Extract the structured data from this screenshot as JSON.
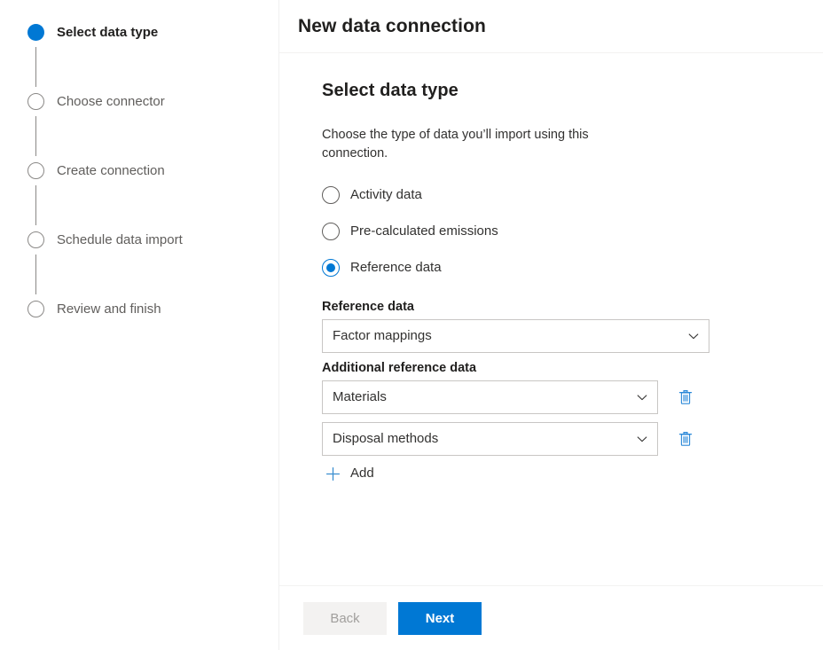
{
  "stepper": {
    "steps": [
      {
        "label": "Select data type",
        "state": "active"
      },
      {
        "label": "Choose connector",
        "state": "inactive"
      },
      {
        "label": "Create connection",
        "state": "inactive"
      },
      {
        "label": "Schedule data import",
        "state": "inactive"
      },
      {
        "label": "Review and finish",
        "state": "inactive"
      }
    ]
  },
  "panel": {
    "title": "New data connection",
    "section_title": "Select data type",
    "description": "Choose the type of data you’ll import using this connection.",
    "radio_options": [
      {
        "label": "Activity data",
        "checked": false
      },
      {
        "label": "Pre-calculated emissions",
        "checked": false
      },
      {
        "label": "Reference data",
        "checked": true
      }
    ],
    "reference_data": {
      "label": "Reference data",
      "value": "Factor mappings"
    },
    "additional_reference_data": {
      "label": "Additional reference data",
      "items": [
        {
          "value": "Materials",
          "delete_label": "Delete"
        },
        {
          "value": "Disposal methods",
          "delete_label": "Delete"
        }
      ],
      "add_label": "Add"
    }
  },
  "footer": {
    "back_label": "Back",
    "next_label": "Next"
  },
  "colors": {
    "accent": "#0078d4",
    "border": "#c8c6c4",
    "text_primary": "#201f1e",
    "text_secondary": "#605e5c",
    "disabled_bg": "#f3f2f1",
    "disabled_text": "#a19f9d"
  }
}
